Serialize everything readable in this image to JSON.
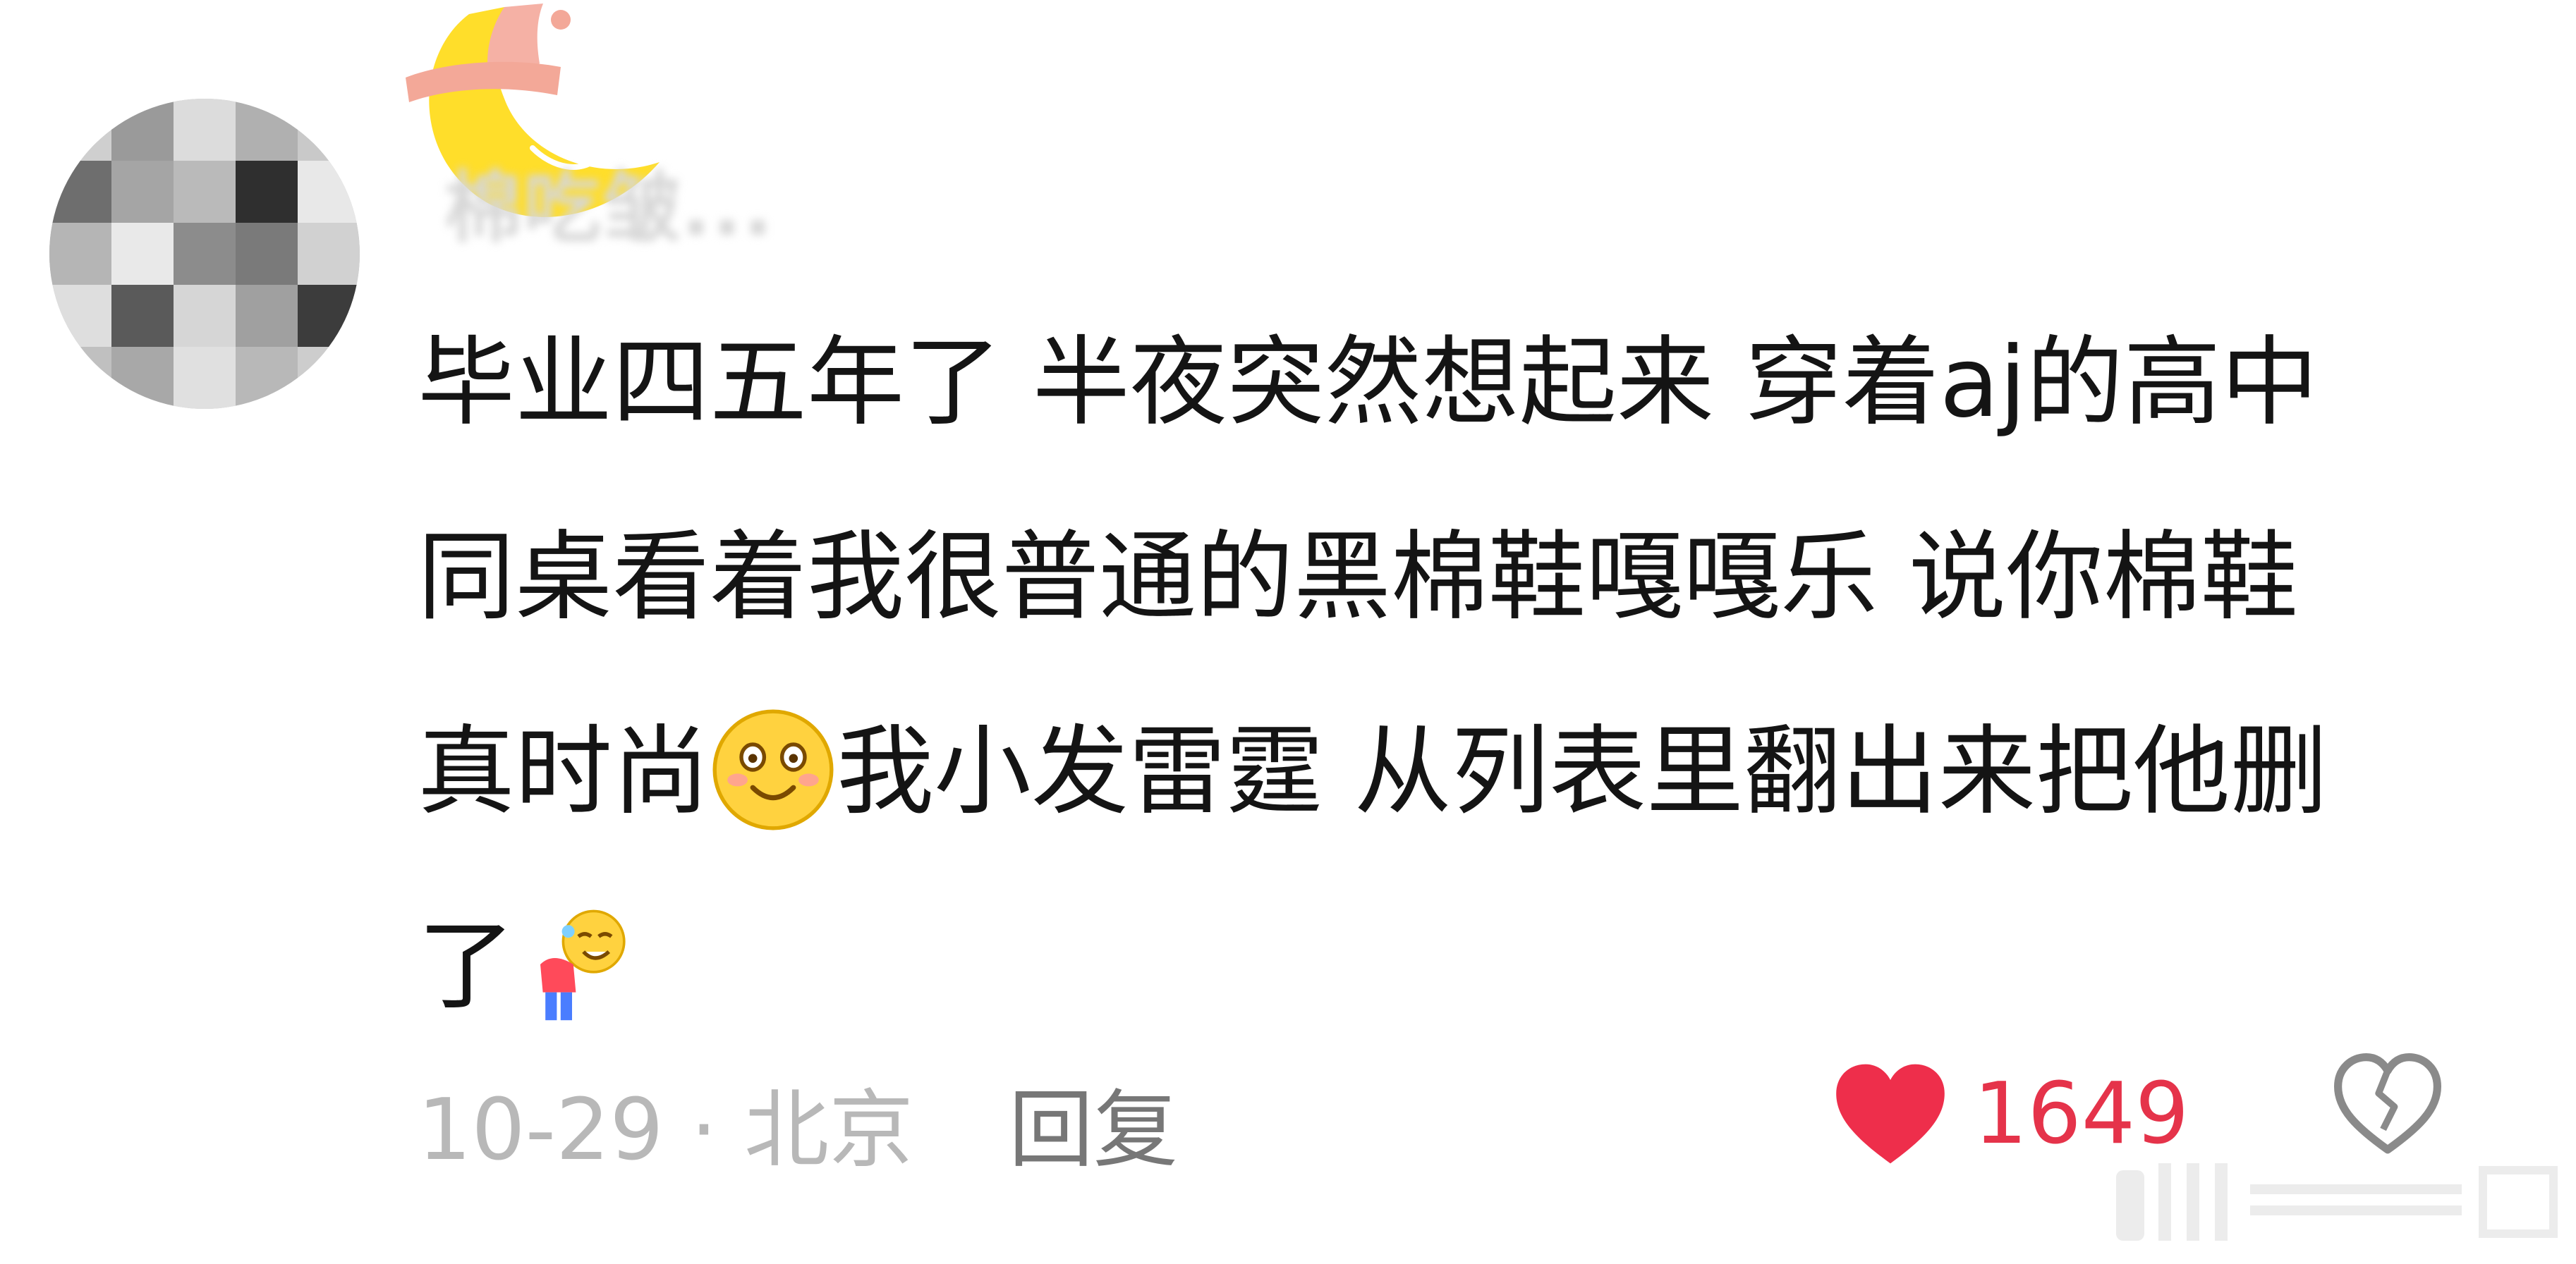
{
  "comment": {
    "username": "棉吃皱...",
    "lines": [
      "毕业四五年了 半夜突然想起来 穿着aj的高中",
      "同桌看着我很普通的黑棉鞋嘎嘎乐 说你棉鞋",
      "真时尚",
      "我小发雷霆 从列表里翻出来把他删",
      "了"
    ],
    "emoji_after_line3_part1": "smiling-blush-emoji",
    "emoji_end": "bowing-person-emoji",
    "date": "10-29",
    "separator": "·",
    "location": "北京",
    "reply_label": "回复",
    "like_count": "1649",
    "colors": {
      "like": "#e5334a",
      "meta_text": "#b8b8b8",
      "reply_text": "#777777"
    }
  }
}
